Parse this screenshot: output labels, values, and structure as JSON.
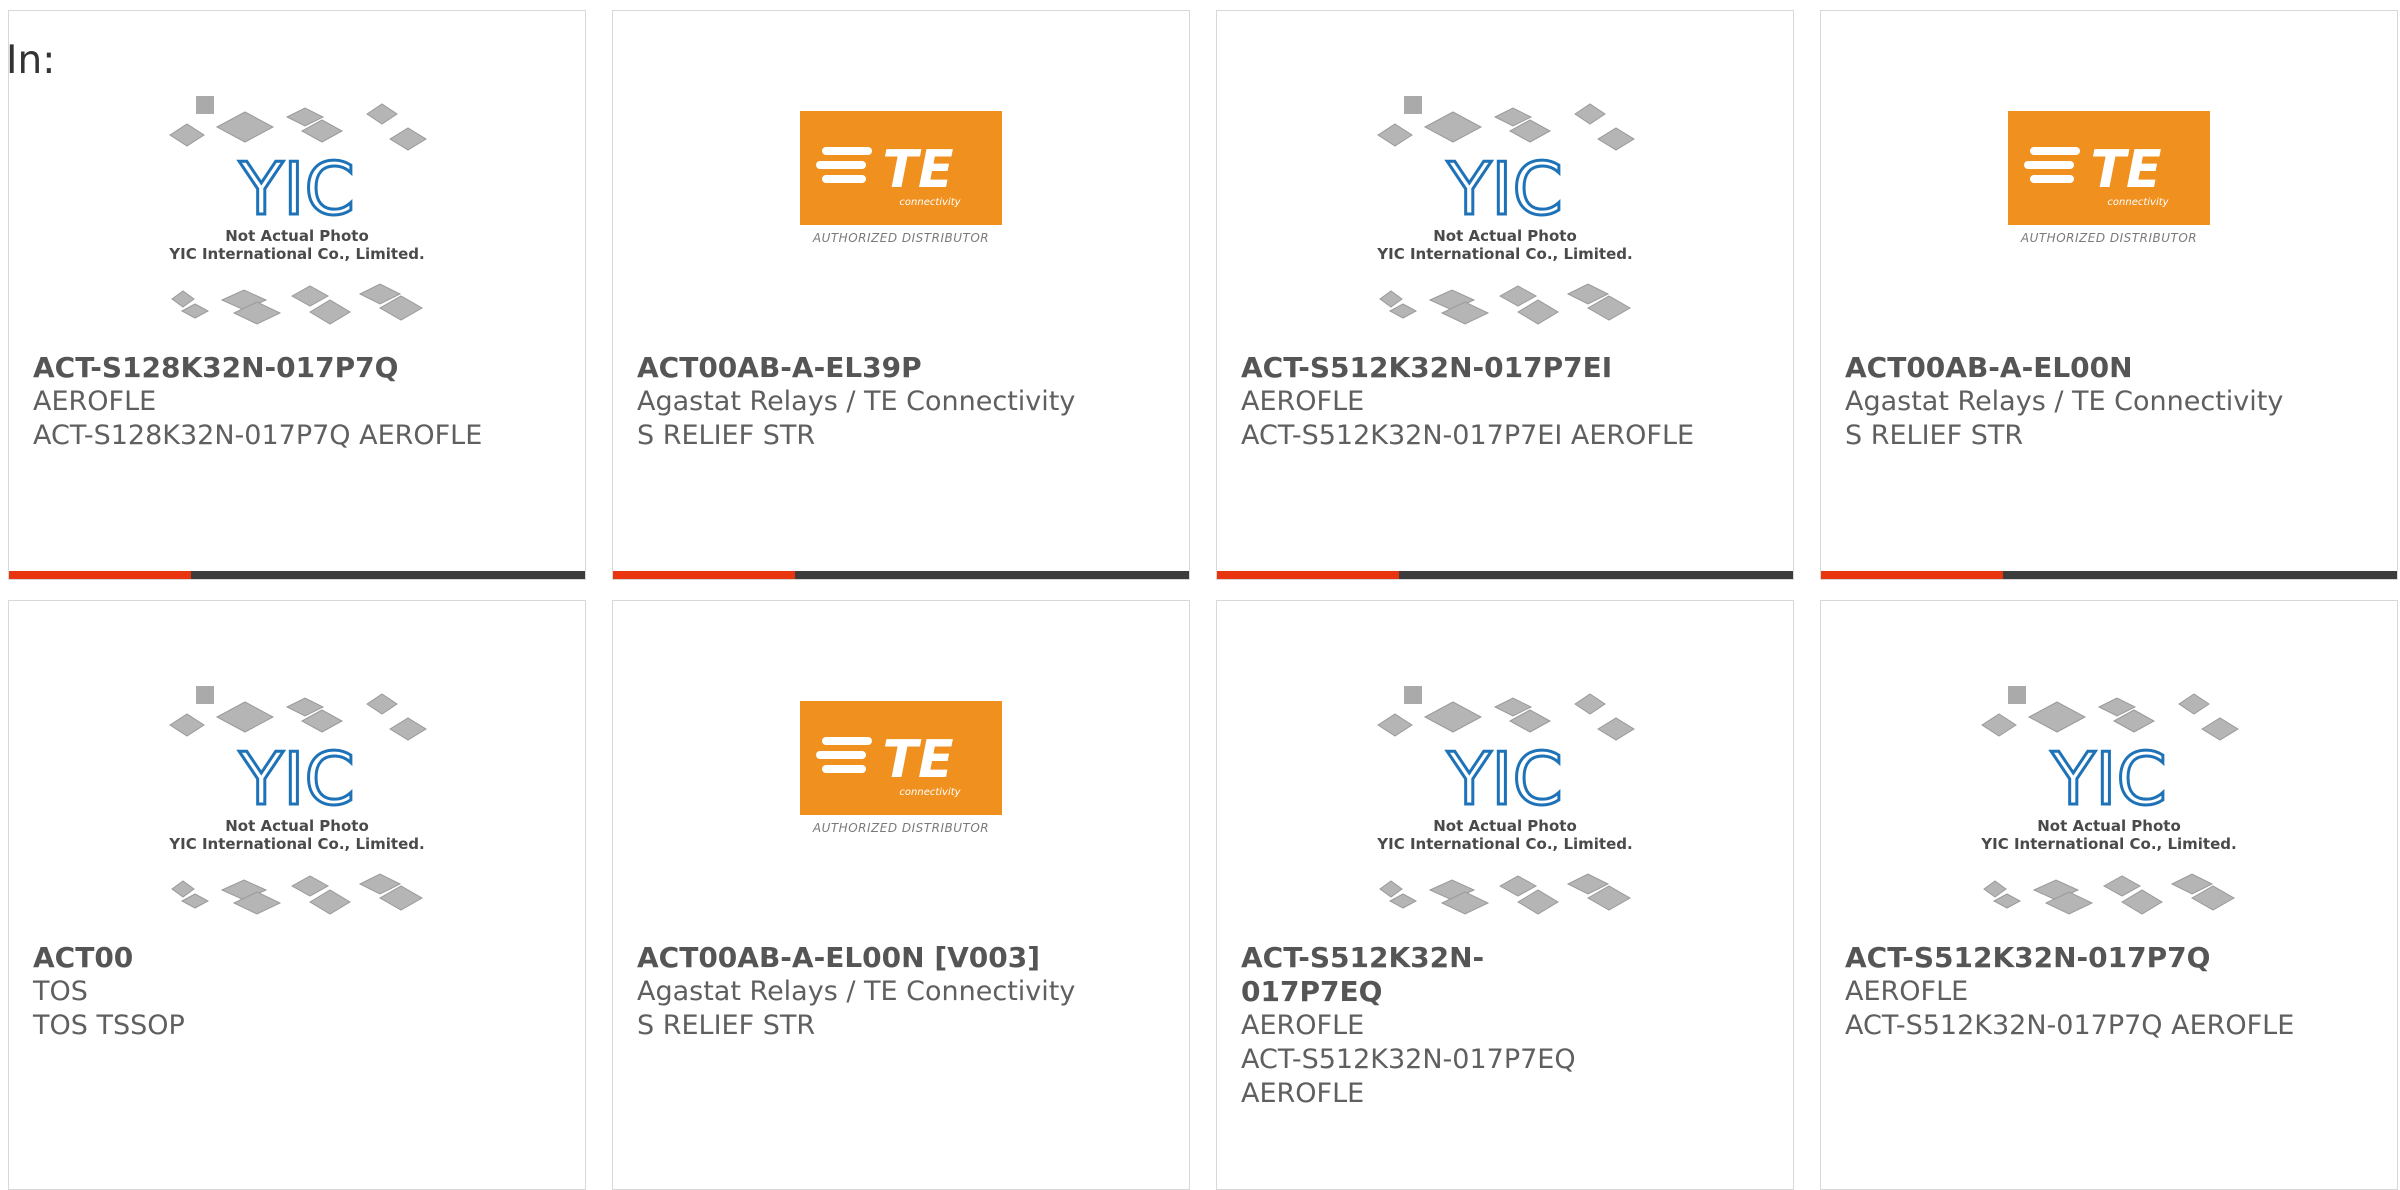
{
  "prefix_label": "In:",
  "yic_caption": {
    "line1": "Not Actual Photo",
    "line2": "YIC International Co., Limited."
  },
  "te_logo": {
    "wordmark": "TE",
    "tagline": "connectivity",
    "subcaption": "AUTHORIZED DISTRIBUTOR",
    "color": "#f0901e"
  },
  "accent_colors": {
    "bar_red": "#e8350f",
    "bar_dark": "#3c3c3c",
    "yic_blue": "#1e73b8"
  },
  "products": [
    {
      "image": "yic-placeholder",
      "part": "ACT-S128K32N-017P7Q",
      "maker": "AEROFLE",
      "desc": "ACT-S128K32N-017P7Q AEROFLE"
    },
    {
      "image": "te-logo",
      "part": "ACT00AB-A-EL39P",
      "maker": "Agastat Relays / TE Connectivity",
      "desc": "S RELIEF STR"
    },
    {
      "image": "yic-placeholder",
      "part": "ACT-S512K32N-017P7EI",
      "maker": "AEROFLE",
      "desc": "ACT-S512K32N-017P7EI AEROFLE"
    },
    {
      "image": "te-logo",
      "part": "ACT00AB-A-EL00N",
      "maker": "Agastat Relays / TE Connectivity",
      "desc": "S RELIEF STR"
    },
    {
      "image": "yic-placeholder",
      "part": "ACT00",
      "maker": "TOS",
      "desc": "TOS TSSOP"
    },
    {
      "image": "te-logo",
      "part": "ACT00AB-A-EL00N [V003]",
      "maker": "Agastat Relays / TE Connectivity",
      "desc": "S RELIEF STR"
    },
    {
      "image": "yic-placeholder",
      "part": "ACT-S512K32N-017P7EQ",
      "maker": "AEROFLE",
      "desc": "ACT-S512K32N-017P7EQ AEROFLE"
    },
    {
      "image": "yic-placeholder",
      "part": "ACT-S512K32N-017P7Q",
      "maker": "AEROFLE",
      "desc": "ACT-S512K32N-017P7Q AEROFLE"
    }
  ]
}
